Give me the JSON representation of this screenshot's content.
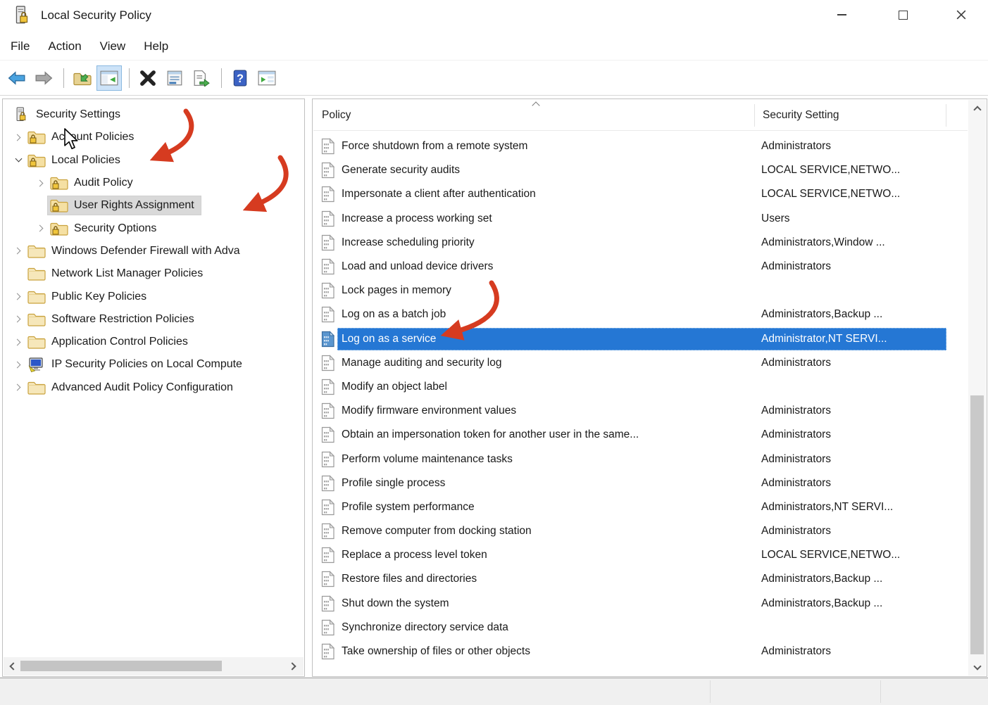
{
  "window": {
    "title": "Local Security Policy",
    "icon": "security-policy-icon",
    "controls": [
      "minimize-icon",
      "maximize-icon",
      "close-icon"
    ]
  },
  "menu": {
    "items": [
      "File",
      "Action",
      "View",
      "Help"
    ]
  },
  "toolbar": {
    "icons": [
      "back-icon",
      "forward-icon",
      "up-folder-icon",
      "show-console-tree-icon",
      "delete-icon",
      "properties-icon",
      "export-list-icon",
      "help-icon",
      "new-window-icon"
    ]
  },
  "tree": {
    "items": [
      {
        "label": "Security Settings",
        "level": 0,
        "icon": "security-root-icon",
        "expander": "none",
        "selected": false
      },
      {
        "label": "Account Policies",
        "level": 1,
        "icon": "folder-lock-icon",
        "expander": "collapsed",
        "selected": false
      },
      {
        "label": "Local Policies",
        "level": 1,
        "icon": "folder-lock-icon",
        "expander": "expanded",
        "selected": false
      },
      {
        "label": "Audit Policy",
        "level": 2,
        "icon": "folder-lock-icon",
        "expander": "collapsed",
        "selected": false
      },
      {
        "label": "User Rights Assignment",
        "level": 2,
        "icon": "folder-lock-icon",
        "expander": "none",
        "selected": true
      },
      {
        "label": "Security Options",
        "level": 2,
        "icon": "folder-lock-icon",
        "expander": "collapsed",
        "selected": false
      },
      {
        "label": "Windows Defender Firewall with Adva",
        "level": 1,
        "icon": "folder-icon",
        "expander": "collapsed",
        "selected": false
      },
      {
        "label": "Network List Manager Policies",
        "level": 1,
        "icon": "folder-icon",
        "expander": "none",
        "selected": false
      },
      {
        "label": "Public Key Policies",
        "level": 1,
        "icon": "folder-icon",
        "expander": "collapsed",
        "selected": false
      },
      {
        "label": "Software Restriction Policies",
        "level": 1,
        "icon": "folder-icon",
        "expander": "collapsed",
        "selected": false
      },
      {
        "label": "Application Control Policies",
        "level": 1,
        "icon": "folder-icon",
        "expander": "collapsed",
        "selected": false
      },
      {
        "label": "IP Security Policies on Local Compute",
        "level": 1,
        "icon": "ipsec-icon",
        "expander": "collapsed",
        "selected": false
      },
      {
        "label": "Advanced Audit Policy Configuration",
        "level": 1,
        "icon": "folder-icon",
        "expander": "collapsed",
        "selected": false
      }
    ]
  },
  "list": {
    "columns": [
      "Policy",
      "Security Setting"
    ],
    "sort": {
      "column": "Policy",
      "direction": "ascending"
    },
    "rows": [
      {
        "policy": "Force shutdown from a remote system",
        "setting": "Administrators",
        "selected": false
      },
      {
        "policy": "Generate security audits",
        "setting": "LOCAL SERVICE,NETWO...",
        "selected": false
      },
      {
        "policy": "Impersonate a client after authentication",
        "setting": "LOCAL SERVICE,NETWO...",
        "selected": false
      },
      {
        "policy": "Increase a process working set",
        "setting": "Users",
        "selected": false
      },
      {
        "policy": "Increase scheduling priority",
        "setting": "Administrators,Window ...",
        "selected": false
      },
      {
        "policy": "Load and unload device drivers",
        "setting": "Administrators",
        "selected": false
      },
      {
        "policy": "Lock pages in memory",
        "setting": "",
        "selected": false
      },
      {
        "policy": "Log on as a batch job",
        "setting": "Administrators,Backup ...",
        "selected": false
      },
      {
        "policy": "Log on as a service",
        "setting": "Administrator,NT SERVI...",
        "selected": true
      },
      {
        "policy": "Manage auditing and security log",
        "setting": "Administrators",
        "selected": false
      },
      {
        "policy": "Modify an object label",
        "setting": "",
        "selected": false
      },
      {
        "policy": "Modify firmware environment values",
        "setting": "Administrators",
        "selected": false
      },
      {
        "policy": "Obtain an impersonation token for another user in the same...",
        "setting": "Administrators",
        "selected": false
      },
      {
        "policy": "Perform volume maintenance tasks",
        "setting": "Administrators",
        "selected": false
      },
      {
        "policy": "Profile single process",
        "setting": "Administrators",
        "selected": false
      },
      {
        "policy": "Profile system performance",
        "setting": "Administrators,NT SERVI...",
        "selected": false
      },
      {
        "policy": "Remove computer from docking station",
        "setting": "Administrators",
        "selected": false
      },
      {
        "policy": "Replace a process level token",
        "setting": "LOCAL SERVICE,NETWO...",
        "selected": false
      },
      {
        "policy": "Restore files and directories",
        "setting": "Administrators,Backup ...",
        "selected": false
      },
      {
        "policy": "Shut down the system",
        "setting": "Administrators,Backup ...",
        "selected": false
      },
      {
        "policy": "Synchronize directory service data",
        "setting": "",
        "selected": false
      },
      {
        "policy": "Take ownership of files or other objects",
        "setting": "Administrators",
        "selected": false
      }
    ]
  },
  "annotations": {
    "color": "#d63b20",
    "arrows": [
      {
        "target": "Local Policies"
      },
      {
        "target": "User Rights Assignment"
      },
      {
        "target": "Log on as a service"
      }
    ],
    "cursor_near": "Local Policies"
  },
  "colors": {
    "selection_blue": "#2577d4",
    "tree_selection_gray": "#d9d9d9",
    "annotation_red": "#d63b20",
    "statusbar_gray": "#f0f0f0",
    "folder_tan": "#f5e0a3"
  }
}
